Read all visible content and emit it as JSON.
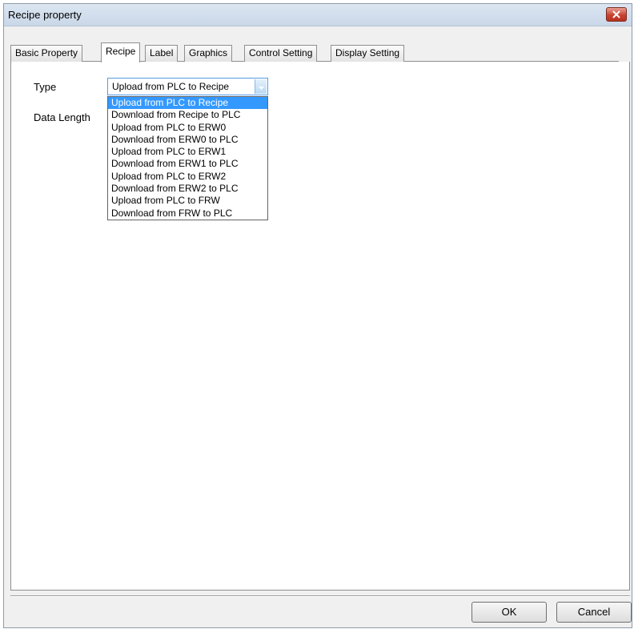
{
  "window": {
    "title": "Recipe property"
  },
  "tabs": [
    {
      "label": "Basic Property",
      "active": false
    },
    {
      "label": "Recipe",
      "active": true
    },
    {
      "label": "Label",
      "active": false
    },
    {
      "label": "Graphics",
      "active": false
    },
    {
      "label": "Control Setting",
      "active": false
    },
    {
      "label": "Display Setting",
      "active": false
    }
  ],
  "form": {
    "type_label": "Type",
    "data_length_label": "Data Length",
    "type_value": "Upload from PLC to Recipe",
    "type_options": [
      "Upload from PLC to Recipe",
      "Download from Recipe to PLC",
      "Upload from PLC to ERW0",
      "Download from ERW0 to PLC",
      "Upload from PLC to ERW1",
      "Download from ERW1 to PLC",
      "Upload from PLC to ERW2",
      "Download from ERW2 to PLC",
      "Upload from PLC to FRW",
      "Download from FRW to PLC"
    ],
    "highlighted_option_index": 0
  },
  "buttons": {
    "ok_label": "OK",
    "cancel_label": "Cancel"
  },
  "icons": {
    "close": "close-icon",
    "dropdown": "chevron-down-icon"
  },
  "colors": {
    "selection": "#3399ff",
    "close_button": "#c84431",
    "focus_border": "#569de5"
  }
}
